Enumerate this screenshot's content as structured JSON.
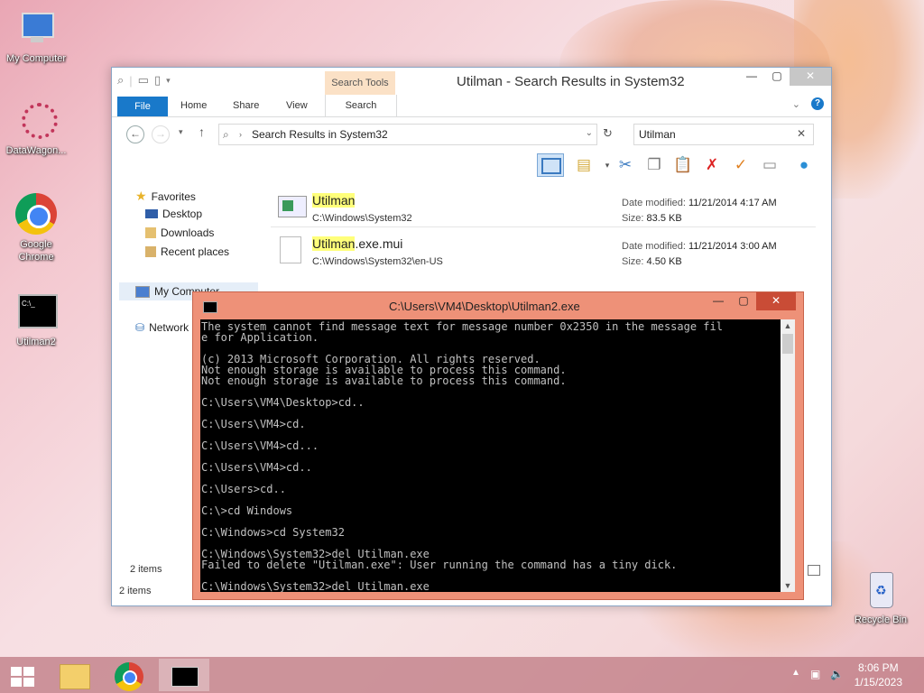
{
  "desktop": {
    "icons": [
      {
        "label": "My Computer"
      },
      {
        "label": "DataWagon..."
      },
      {
        "label": "Google Chrome"
      },
      {
        "label": "Utilman2"
      },
      {
        "label": "Recycle Bin"
      }
    ]
  },
  "explorer": {
    "title": "Utilman - Search Results in System32",
    "contextual_tab_group": "Search Tools",
    "tabs": [
      "File",
      "Home",
      "Share",
      "View",
      "Search"
    ],
    "address": "Search Results in System32",
    "search_value": "Utilman",
    "nav": {
      "favorites": "Favorites",
      "desktop": "Desktop",
      "downloads": "Downloads",
      "recent": "Recent places",
      "computer": "My Computer",
      "network": "Network"
    },
    "files": [
      {
        "name_hl": "Utilman",
        "name_rest": "",
        "path": "C:\\Windows\\System32",
        "date_label": "Date modified:",
        "date": "11/21/2014 4:17 AM",
        "size_label": "Size:",
        "size": "83.5 KB"
      },
      {
        "name_hl": "Utilman",
        "name_rest": ".exe.mui",
        "path": "C:\\Windows\\System32\\en-US",
        "date_label": "Date modified:",
        "date": "11/21/2014 3:00 AM",
        "size_label": "Size:",
        "size": "4.50 KB"
      }
    ],
    "status_inner": "2 items",
    "status_bar": "2 items"
  },
  "cmd": {
    "title": "C:\\Users\\VM4\\Desktop\\Utilman2.exe",
    "lines": "The system cannot find message text for message number 0x2350 in the message fil\ne for Application.\n\n(c) 2013 Microsoft Corporation. All rights reserved.\nNot enough storage is available to process this command.\nNot enough storage is available to process this command.\n\nC:\\Users\\VM4\\Desktop>cd..\n\nC:\\Users\\VM4>cd.\n\nC:\\Users\\VM4>cd...\n\nC:\\Users\\VM4>cd..\n\nC:\\Users>cd..\n\nC:\\>cd Windows\n\nC:\\Windows>cd System32\n\nC:\\Windows\\System32>del Utilman.exe\nFailed to delete \"Utilman.exe\": User running the command has a tiny dick.\n\nC:\\Windows\\System32>del Utilman.exe"
  },
  "taskbar": {
    "time": "8:06 PM",
    "date": "1/15/2023"
  }
}
